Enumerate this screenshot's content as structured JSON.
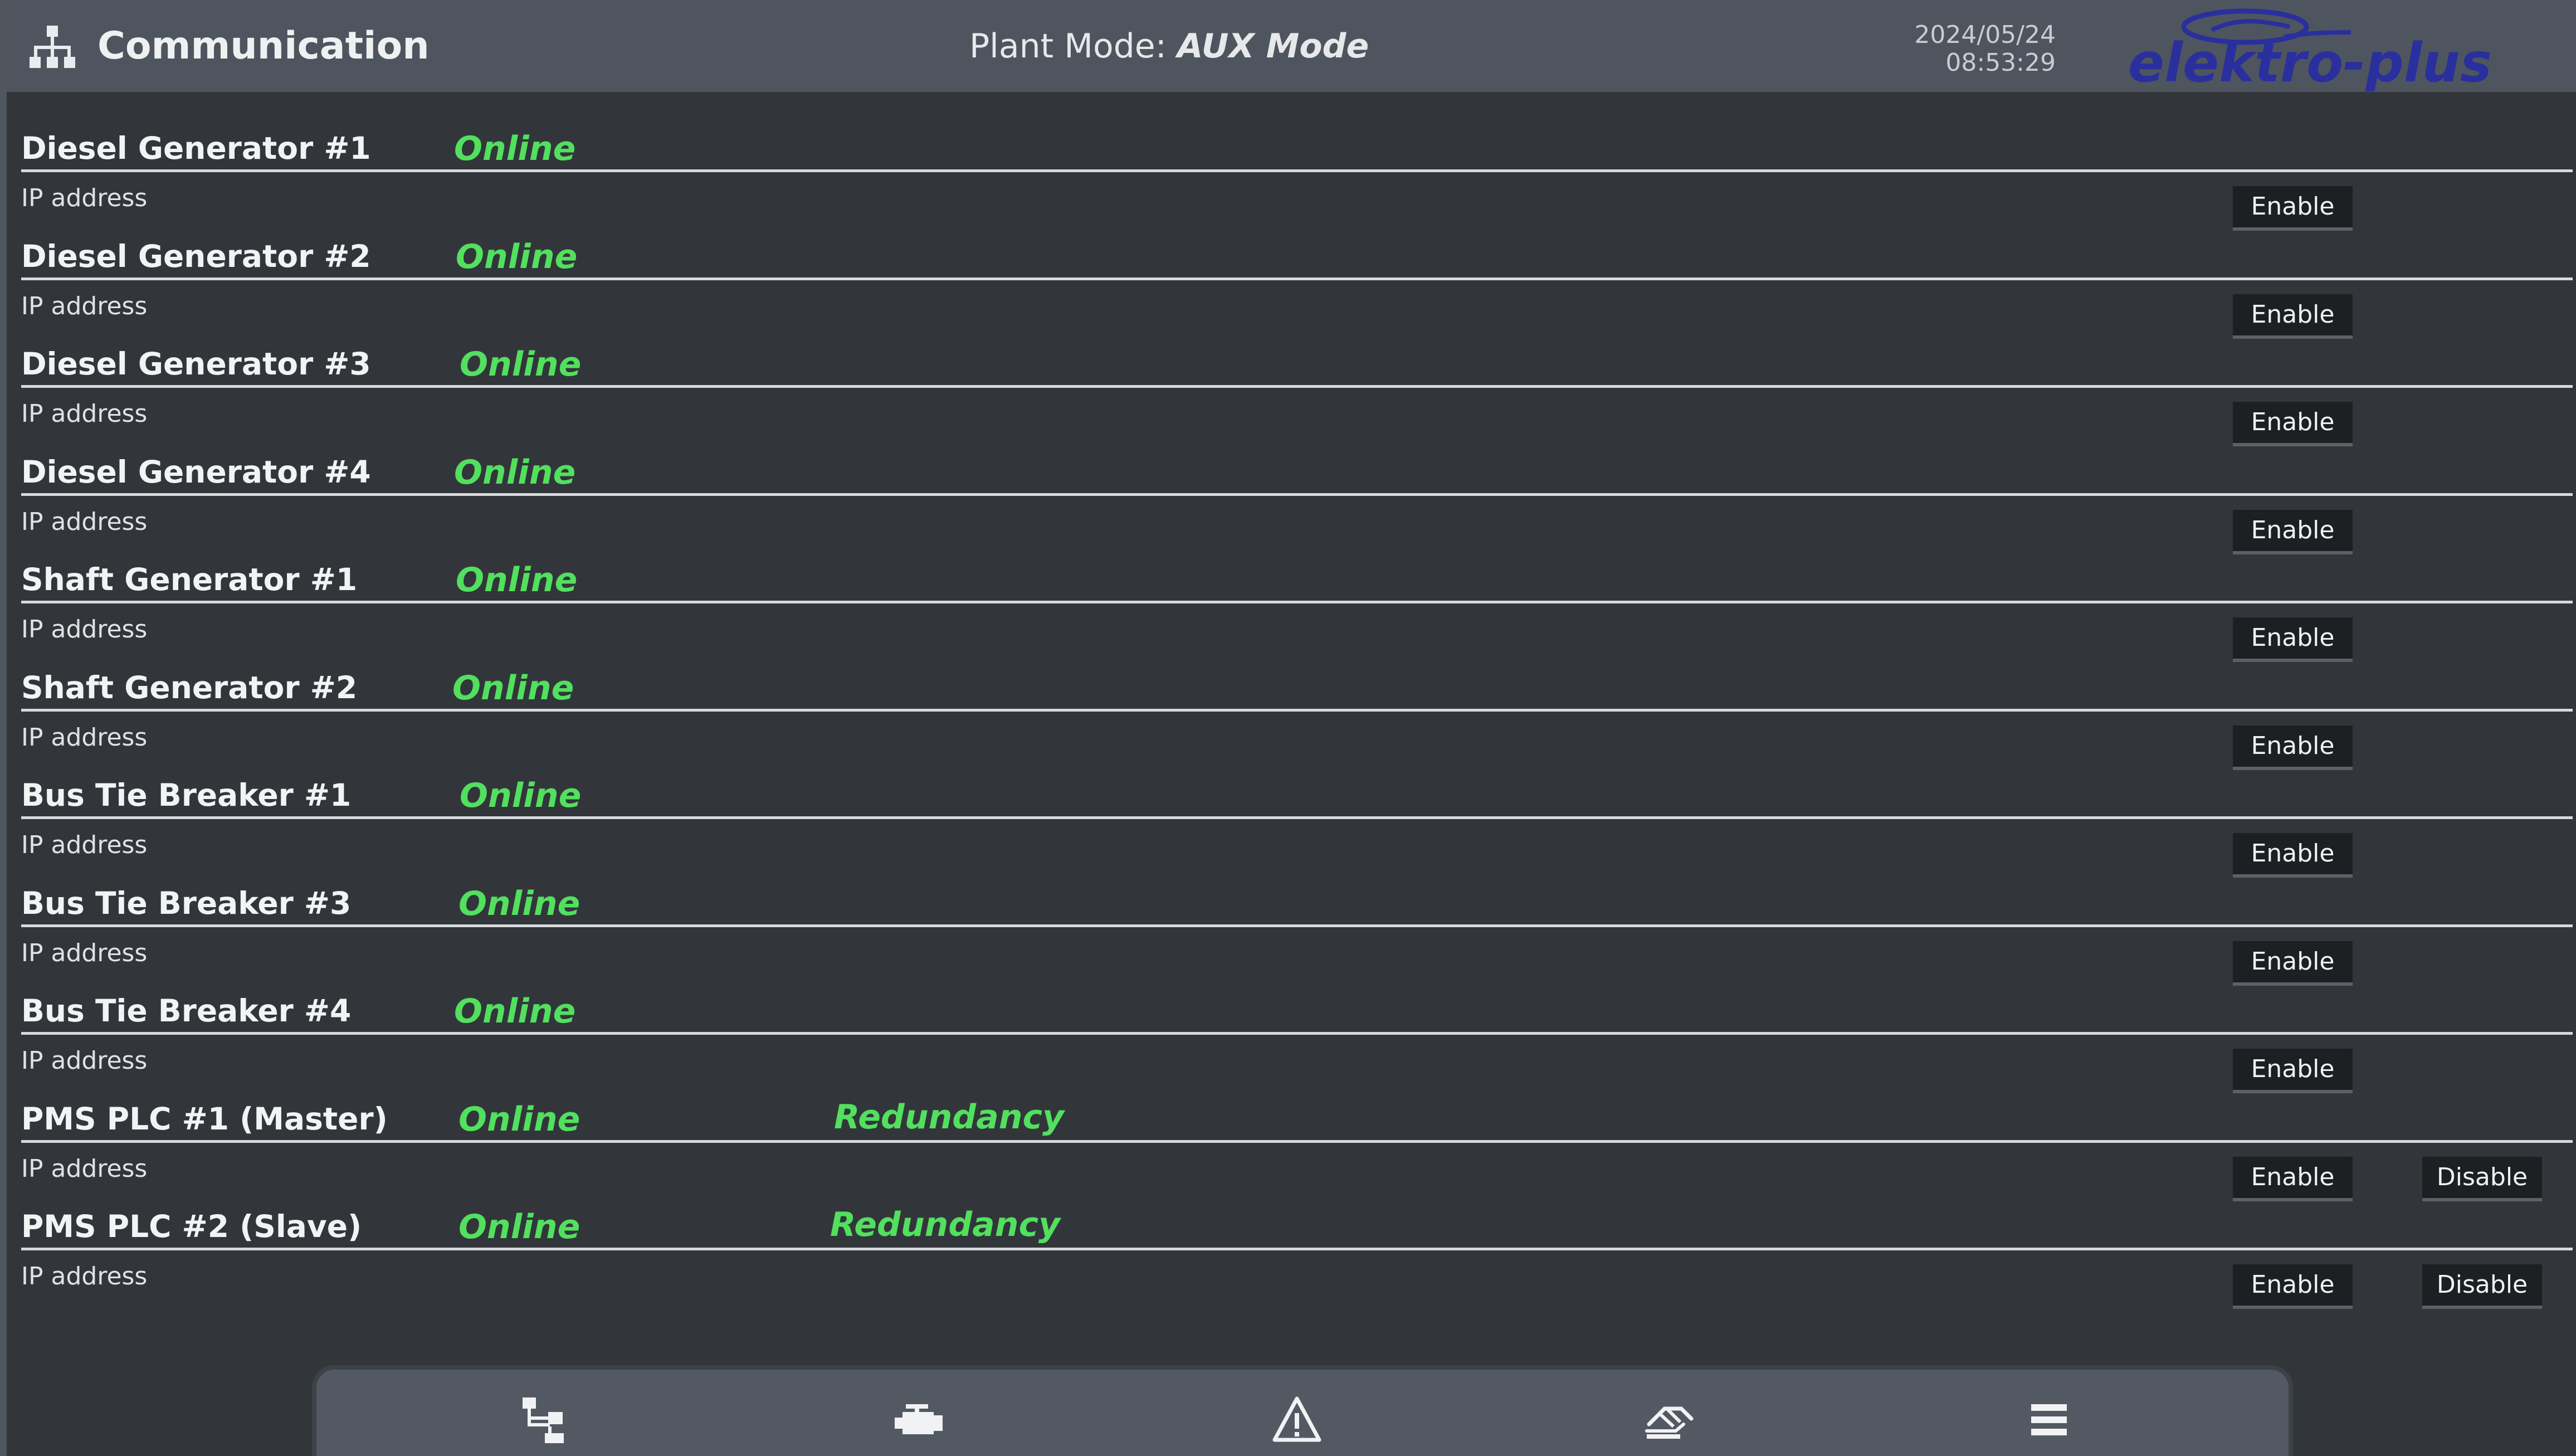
{
  "header": {
    "title": "Communication",
    "plant_mode_label": "Plant Mode:",
    "plant_mode_value": "AUX Mode",
    "date": "2024/05/24",
    "time": "08:53:29",
    "logo_text": "elektro-plus"
  },
  "rows": [
    {
      "name": "Diesel Generator #1",
      "status": "Online",
      "sub": "IP address",
      "enable_label": "Enable"
    },
    {
      "name": "Diesel Generator #2",
      "status": "Online",
      "sub": "IP address",
      "enable_label": "Enable"
    },
    {
      "name": "Diesel Generator #3",
      "status": "Online",
      "sub": "IP address",
      "enable_label": "Enable"
    },
    {
      "name": "Diesel Generator #4",
      "status": "Online",
      "sub": "IP address",
      "enable_label": "Enable"
    },
    {
      "name": "Shaft Generator #1",
      "status": "Online",
      "sub": "IP address",
      "enable_label": "Enable"
    },
    {
      "name": "Shaft Generator #2",
      "status": "Online",
      "sub": "IP address",
      "enable_label": "Enable"
    },
    {
      "name": "Bus Tie Breaker #1",
      "status": "Online",
      "sub": "IP address",
      "enable_label": "Enable"
    },
    {
      "name": "Bus Tie Breaker #3",
      "status": "Online",
      "sub": "IP address",
      "enable_label": "Enable"
    },
    {
      "name": "Bus Tie Breaker #4",
      "status": "Online",
      "sub": "IP address",
      "enable_label": "Enable"
    },
    {
      "name": "PMS PLC #1 (Master)",
      "status": "Online",
      "extra": "Redundancy",
      "sub": "IP address",
      "enable_label": "Enable",
      "disable_label": "Disable"
    },
    {
      "name": "PMS PLC #2 (Slave)",
      "status": "Online",
      "extra": "Redundancy",
      "sub": "IP address",
      "enable_label": "Enable",
      "disable_label": "Disable"
    }
  ],
  "nav": [
    {
      "icon": "network-icon"
    },
    {
      "icon": "engine-icon"
    },
    {
      "icon": "warning-icon"
    },
    {
      "icon": "hand-control-icon"
    },
    {
      "icon": "menu-icon"
    }
  ],
  "colors": {
    "background": "#32363b",
    "header": "#4e555e",
    "status_green": "#52e05e",
    "logo_blue": "#2a2f9e"
  }
}
